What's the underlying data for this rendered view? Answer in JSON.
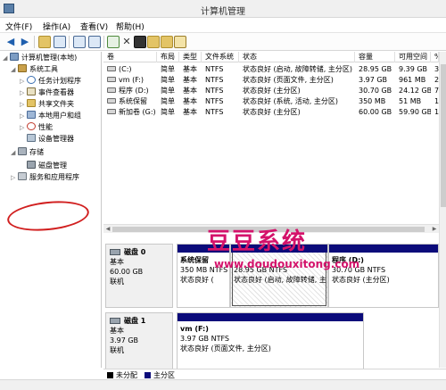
{
  "window": {
    "title": "计算机管理"
  },
  "menu": [
    "文件(F)",
    "操作(A)",
    "查看(V)",
    "帮助(H)"
  ],
  "toolbar": {
    "back": "◀",
    "forward": "▶",
    "delete": "✕"
  },
  "tree": [
    {
      "label": "计算机管理(本地)",
      "icon": "computer-icon"
    },
    {
      "label": "系统工具",
      "icon": "tools-icon"
    },
    {
      "label": "任务计划程序",
      "icon": "clock-icon"
    },
    {
      "label": "事件查看器",
      "icon": "event-viewer-icon"
    },
    {
      "label": "共享文件夹",
      "icon": "shared-folder-icon"
    },
    {
      "label": "本地用户和组",
      "icon": "users-icon"
    },
    {
      "label": "性能",
      "icon": "performance-icon"
    },
    {
      "label": "设备管理器",
      "icon": "device-manager-icon"
    },
    {
      "label": "存储",
      "icon": "storage-icon"
    },
    {
      "label": "磁盘管理",
      "icon": "disk-icon"
    },
    {
      "label": "服务和应用程序",
      "icon": "services-icon"
    }
  ],
  "volumes": {
    "columns": [
      "卷",
      "布局",
      "类型",
      "文件系统",
      "状态",
      "容量",
      "可用空间",
      "%"
    ],
    "rows": [
      [
        "(C:)",
        "简单",
        "基本",
        "NTFS",
        "状态良好 (启动, 故障转储, 主分区)",
        "28.95 GB",
        "9.39 GB",
        "3"
      ],
      [
        "vm (F:)",
        "简单",
        "基本",
        "NTFS",
        "状态良好 (页面文件, 主分区)",
        "3.97 GB",
        "961 MB",
        "2"
      ],
      [
        "程序 (D:)",
        "简单",
        "基本",
        "NTFS",
        "状态良好 (主分区)",
        "30.70 GB",
        "24.12 GB",
        "7"
      ],
      [
        "系统保留",
        "简单",
        "基本",
        "NTFS",
        "状态良好 (系统, 活动, 主分区)",
        "350 MB",
        "51 MB",
        "1"
      ],
      [
        "新加卷 (G:)",
        "简单",
        "基本",
        "NTFS",
        "状态良好 (主分区)",
        "60.00 GB",
        "59.90 GB",
        "1"
      ]
    ]
  },
  "disks": [
    {
      "name": "磁盘 0",
      "type": "基本",
      "size": "60.00 GB",
      "state": "联机",
      "partitions": [
        {
          "name": "系统保留",
          "size": "350 MB NTFS",
          "status": "状态良好 ("
        },
        {
          "name": "",
          "size": "28.95 GB NTFS",
          "status": "状态良好 (启动, 故障转储, 主"
        },
        {
          "name": "程序 (D:)",
          "size": "30.70 GB NTFS",
          "status": "状态良好 (主分区)"
        }
      ]
    },
    {
      "name": "磁盘 1",
      "type": "基本",
      "size": "3.97 GB",
      "state": "联机",
      "partitions": [
        {
          "name": "vm (F:)",
          "size": "3.97 GB NTFS",
          "status": "状态良好 (页面文件, 主分区)"
        }
      ]
    }
  ],
  "legend": [
    {
      "label": "未分配",
      "color": "#000000"
    },
    {
      "label": "主分区",
      "color": "#0b0b7a"
    }
  ],
  "watermark": {
    "title": "豆豆系统",
    "url": "www.doudouxitong.com"
  },
  "colors": {
    "partition_bar": "#0b0b7a",
    "annotation": "#d11f1f",
    "watermark": "#d4136b"
  }
}
